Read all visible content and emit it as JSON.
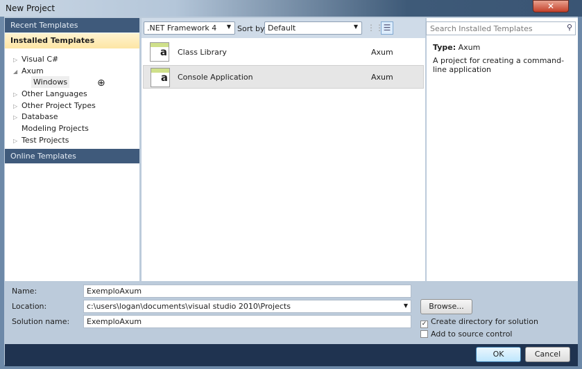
{
  "window": {
    "title": "New Project",
    "close_icon": "x-icon"
  },
  "left": {
    "recent": "Recent Templates",
    "installed": "Installed Templates",
    "online": "Online Templates",
    "tree": [
      {
        "label": "Visual C#",
        "arrow": "▷"
      },
      {
        "label": "Axum",
        "arrow": "◢"
      },
      {
        "label": "Windows",
        "arrow": ""
      },
      {
        "label": "Other Languages",
        "arrow": "▷"
      },
      {
        "label": "Other Project Types",
        "arrow": "▷"
      },
      {
        "label": "Database",
        "arrow": "▷"
      },
      {
        "label": "Modeling Projects",
        "arrow": ""
      },
      {
        "label": "Test Projects",
        "arrow": "▷"
      }
    ]
  },
  "toolbar": {
    "framework": ".NET Framework 4",
    "sort_label": "Sort by:",
    "sort": "Default"
  },
  "templates": [
    {
      "name": "Class Library",
      "lang": "Axum",
      "selected": false
    },
    {
      "name": "Console Application",
      "lang": "Axum",
      "selected": true
    }
  ],
  "details": {
    "search_placeholder": "Search Installed Templates",
    "type_label": "Type:",
    "type": "Axum",
    "description": "A project for creating a command-line application"
  },
  "form": {
    "name_label": "Name:",
    "name": "ExemploAxum",
    "location_label": "Location:",
    "location": "c:\\users\\logan\\documents\\visual studio 2010\\Projects",
    "solution_label": "Solution name:",
    "solution": "ExemploAxum",
    "browse": "Browse...",
    "create_dir": "Create directory for solution",
    "create_dir_checked": true,
    "source_control": "Add to source control",
    "source_control_checked": false
  },
  "buttons": {
    "ok": "OK",
    "cancel": "Cancel"
  }
}
